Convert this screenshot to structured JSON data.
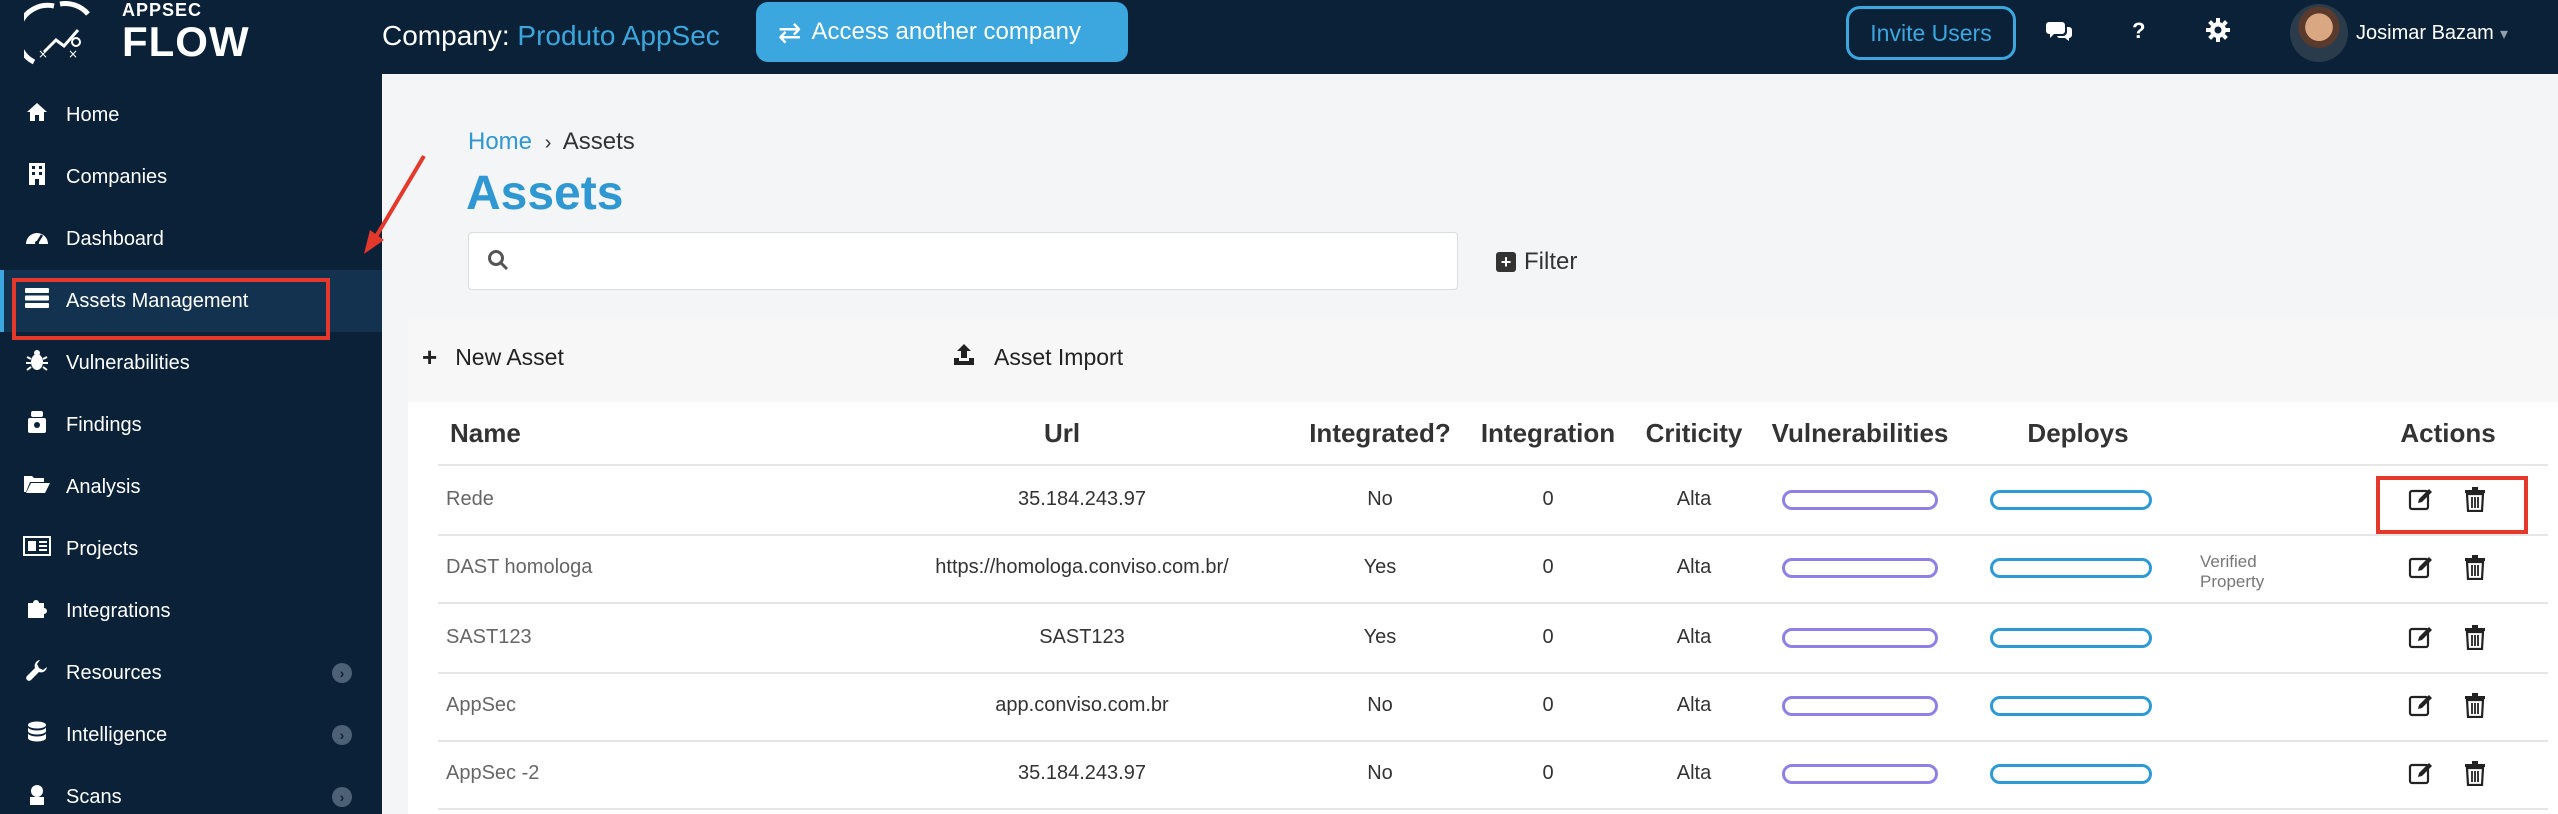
{
  "logo": {
    "top": "APPSEC",
    "bottom": "FLOW"
  },
  "header": {
    "company_prefix": "Company:",
    "company_name": "Produto AppSec",
    "access_label": "Access another company",
    "invite_label": "Invite Users",
    "help_label": "?",
    "user_name": "Josimar Bazam"
  },
  "sidebar": {
    "items": [
      {
        "label": "Home",
        "icon": "home-icon"
      },
      {
        "label": "Companies",
        "icon": "building-icon"
      },
      {
        "label": "Dashboard",
        "icon": "dashboard-icon"
      },
      {
        "label": "Assets Management",
        "icon": "server-icon",
        "active": true
      },
      {
        "label": "Vulnerabilities",
        "icon": "bug-icon"
      },
      {
        "label": "Findings",
        "icon": "findings-icon"
      },
      {
        "label": "Analysis",
        "icon": "folder-open-icon"
      },
      {
        "label": "Projects",
        "icon": "newspaper-icon"
      },
      {
        "label": "Integrations",
        "icon": "puzzle-icon"
      },
      {
        "label": "Resources",
        "icon": "wrench-icon",
        "expandable": true
      },
      {
        "label": "Intelligence",
        "icon": "database-icon",
        "expandable": true
      },
      {
        "label": "Scans",
        "icon": "scan-icon",
        "expandable": true
      }
    ]
  },
  "breadcrumb": {
    "home": "Home",
    "separator": "›",
    "current": "Assets"
  },
  "page_title": "Assets",
  "search": {
    "placeholder": ""
  },
  "filter_label": "Filter",
  "toolbar": {
    "new_asset": "New Asset",
    "asset_import": "Asset Import"
  },
  "table": {
    "columns": [
      "Name",
      "Url",
      "Integrated?",
      "Integration",
      "Criticity",
      "Vulnerabilities",
      "Deploys",
      "Actions"
    ],
    "rows": [
      {
        "name": "Rede",
        "url": "35.184.243.97",
        "integrated": "No",
        "integration": "0",
        "criticity": "Alta",
        "note": ""
      },
      {
        "name": "DAST homologa",
        "url": "https://homologa.conviso.com.br/",
        "integrated": "Yes",
        "integration": "0",
        "criticity": "Alta",
        "note": "Verified Property"
      },
      {
        "name": "SAST123",
        "url": "SAST123",
        "integrated": "Yes",
        "integration": "0",
        "criticity": "Alta",
        "note": ""
      },
      {
        "name": "AppSec",
        "url": "app.conviso.com.br",
        "integrated": "No",
        "integration": "0",
        "criticity": "Alta",
        "note": ""
      },
      {
        "name": "AppSec -2",
        "url": "35.184.243.97",
        "integrated": "No",
        "integration": "0",
        "criticity": "Alta",
        "note": ""
      }
    ]
  },
  "colors": {
    "navy": "#0a2138",
    "accent": "#3ba7de",
    "highlight": "#e4392a",
    "vuln_bar": "#8f7fe6",
    "deploy_bar": "#2d9ad8"
  }
}
